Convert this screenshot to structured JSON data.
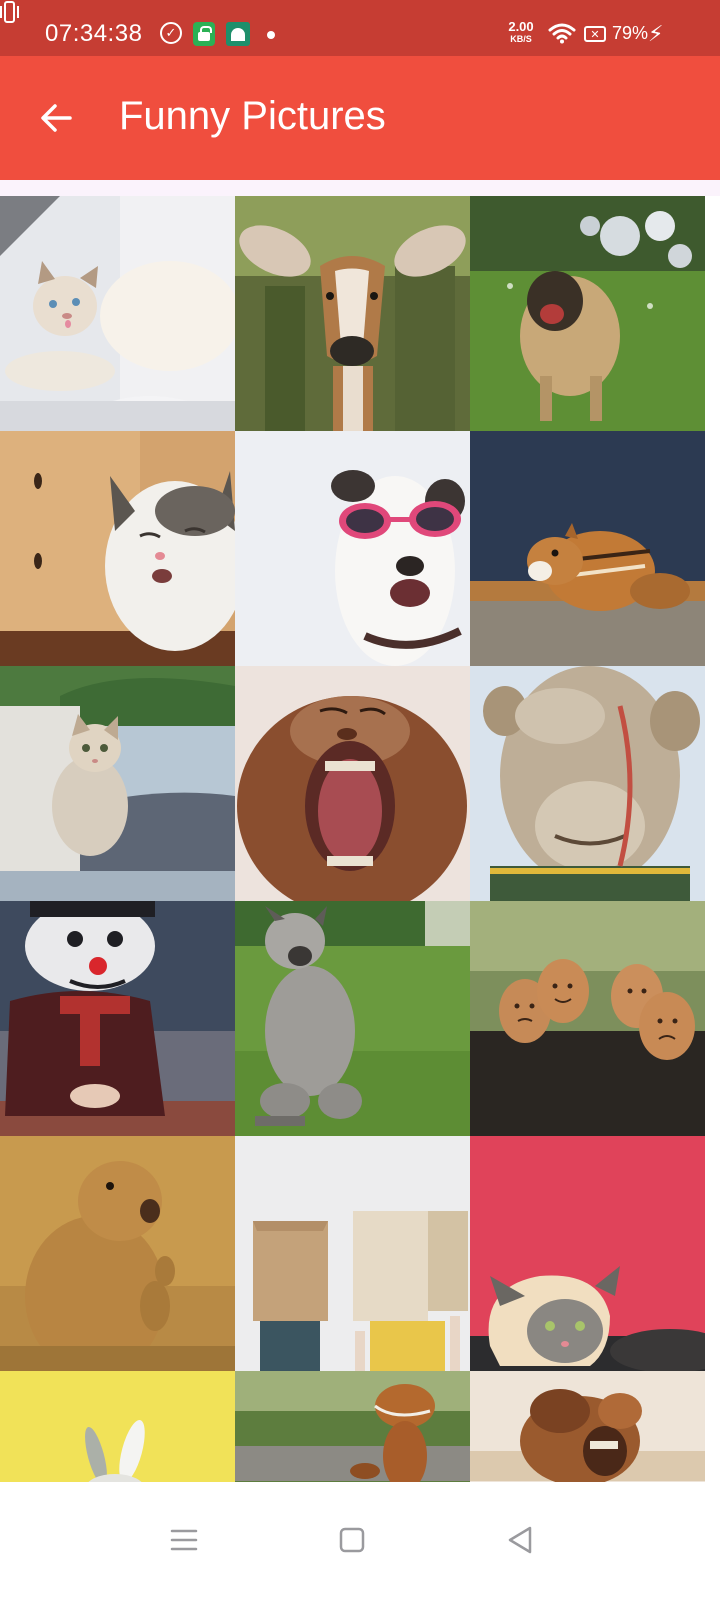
{
  "status_bar": {
    "time": "07:34:38",
    "net_speed_value": "2.00",
    "net_speed_unit": "KB/S",
    "battery_percent": "79%",
    "icons": [
      "check-circle-icon",
      "store-icon",
      "android-icon",
      "notification-dot-icon",
      "vibrate-icon",
      "wifi-icon",
      "battery-icon",
      "charging-bolt-icon"
    ]
  },
  "app_bar": {
    "title": "Funny Pictures",
    "back_icon": "arrow-left-icon",
    "color": "#F04E3E"
  },
  "colors": {
    "status_bar": "#C63D33",
    "app_bar": "#F04E3E",
    "spacer": "#FBF3FC"
  },
  "gallery": {
    "images": [
      {
        "subject": "cat",
        "id": "white-cat-tongue"
      },
      {
        "subject": "gazelle",
        "id": "gazelle-face"
      },
      {
        "subject": "dog",
        "id": "dog-shaking-water"
      },
      {
        "subject": "cat",
        "id": "cat-squinting"
      },
      {
        "subject": "dog",
        "id": "dog-sunglasses"
      },
      {
        "subject": "chipmunk",
        "id": "chipmunk-eating"
      },
      {
        "subject": "kitten",
        "id": "kitten-on-sofa"
      },
      {
        "subject": "monkey",
        "id": "monkey-yawning"
      },
      {
        "subject": "camel",
        "id": "camel-closeup"
      },
      {
        "subject": "snowman",
        "id": "snowman-head-person"
      },
      {
        "subject": "dog",
        "id": "terrier-standing"
      },
      {
        "subject": "eggs",
        "id": "eggs-with-faces"
      },
      {
        "subject": "prairie-dog",
        "id": "prairie-dog"
      },
      {
        "subject": "boxes",
        "id": "people-box-heads"
      },
      {
        "subject": "cat",
        "id": "cat-bread-head"
      },
      {
        "subject": "rabbit",
        "id": "rabbit-ears-yellow"
      },
      {
        "subject": "dinosaur",
        "id": "dinosaur-costume"
      },
      {
        "subject": "camel",
        "id": "camel-laughing"
      }
    ]
  },
  "nav_bar": {
    "icons": [
      "menu-icon",
      "home-square-icon",
      "back-triangle-icon"
    ]
  }
}
